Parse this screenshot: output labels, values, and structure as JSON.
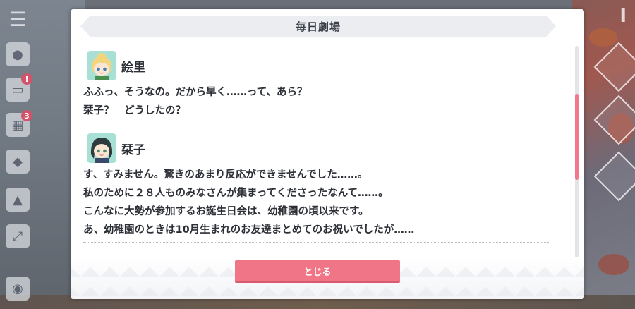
{
  "hud": {
    "badge_1": "!",
    "badge_2": "3"
  },
  "dialog": {
    "title": "毎日劇場",
    "close_label": "とじる"
  },
  "entries": [
    {
      "speaker": "絵里",
      "avatar_icon": "eli-portrait",
      "lines": [
        "ふふっ、そうなの。だから早く……って、あら？",
        "栞子？　どうしたの？"
      ]
    },
    {
      "speaker": "栞子",
      "avatar_icon": "shioriko-portrait",
      "lines": [
        "す、すみません。驚きのあまり反応ができませんでした……。",
        "私のために２８人ものみなさんが集まってくださったなんて……。",
        "こんなに大勢が参加するお誕生日会は、幼稚園の頃以来です。",
        "あ、幼稚園のときは10月生まれのお友達まとめてのお祝いでしたが……"
      ]
    }
  ],
  "colors": {
    "accent": "#f07586",
    "scroll_thumb": "#f0788a",
    "title_bar": "#ebedf1"
  },
  "scroll": {
    "position_fraction": 0.25
  }
}
